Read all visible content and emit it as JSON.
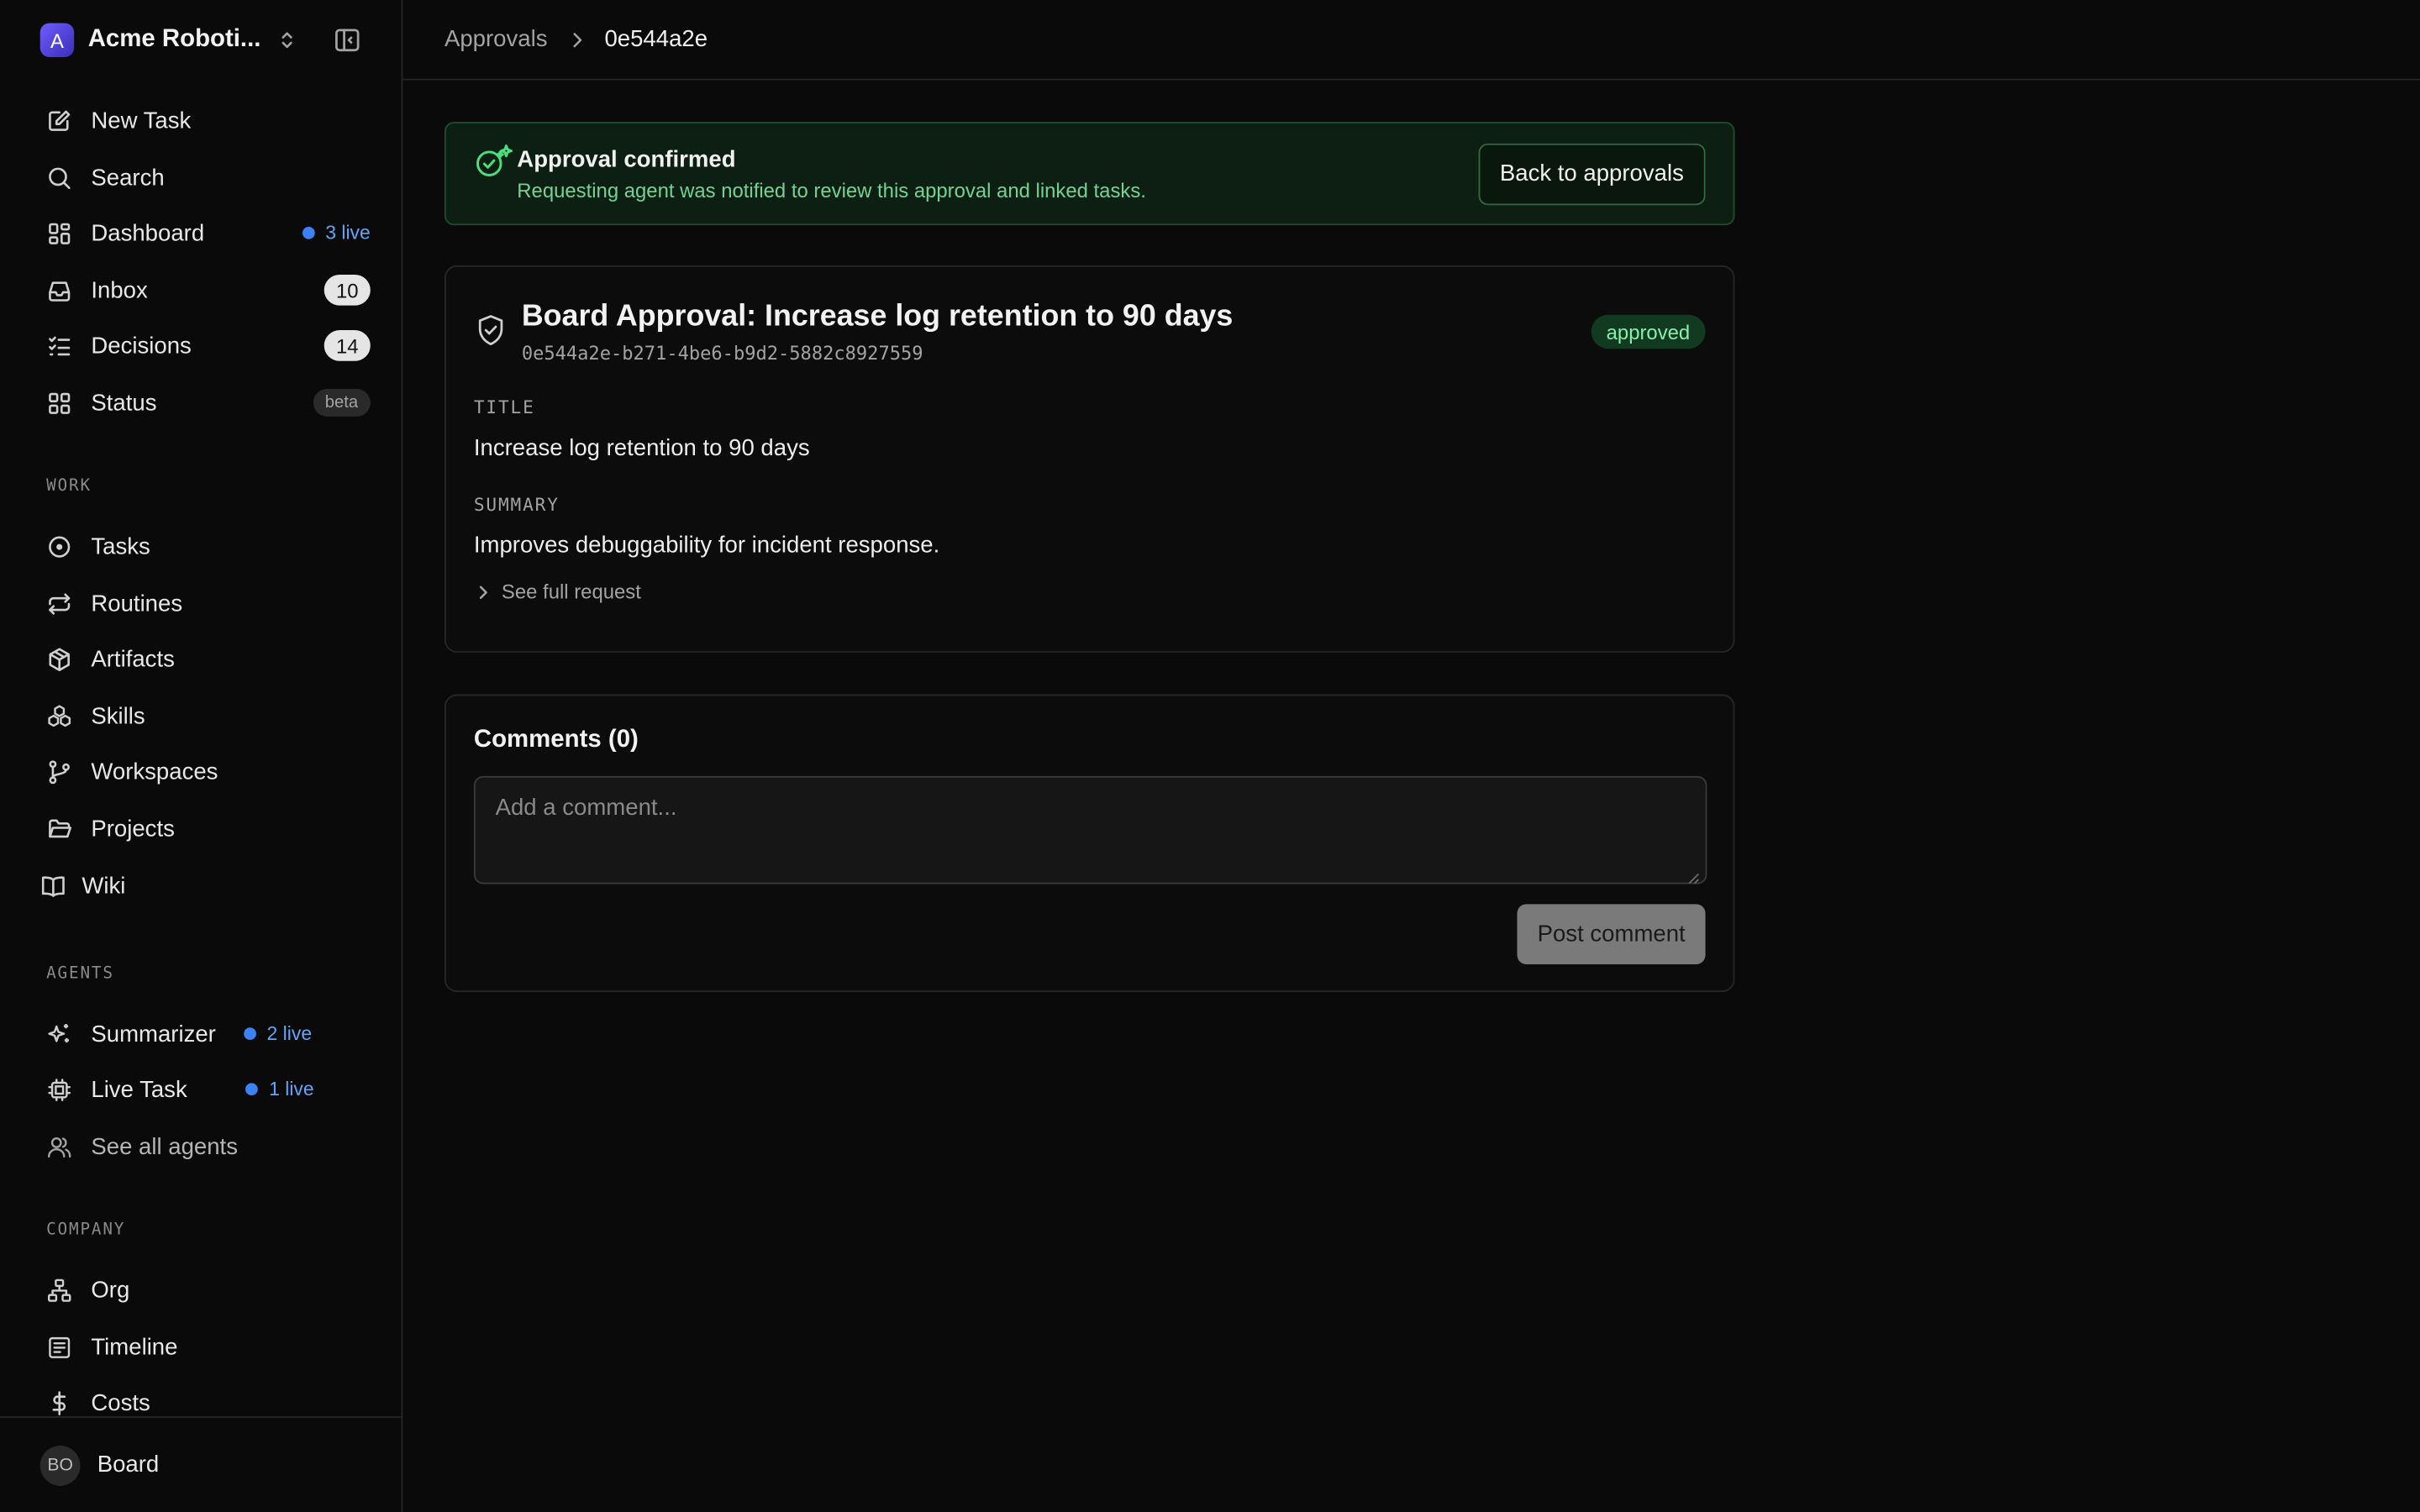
{
  "workspace": {
    "initial": "A",
    "name": "Acme Roboti..."
  },
  "nav_primary": [
    {
      "label": "New Task",
      "icon": "edit-icon"
    },
    {
      "label": "Search",
      "icon": "search-icon"
    },
    {
      "label": "Dashboard",
      "icon": "dashboard-icon",
      "live": "3 live"
    },
    {
      "label": "Inbox",
      "icon": "inbox-icon",
      "count": "10"
    },
    {
      "label": "Decisions",
      "icon": "checklist-icon",
      "count": "14"
    },
    {
      "label": "Status",
      "icon": "grid-icon",
      "badge": "beta"
    }
  ],
  "sections": {
    "work": "WORK",
    "agents": "AGENTS",
    "company": "COMPANY"
  },
  "nav_work": [
    {
      "label": "Tasks"
    },
    {
      "label": "Routines"
    },
    {
      "label": "Artifacts"
    },
    {
      "label": "Skills"
    },
    {
      "label": "Workspaces"
    },
    {
      "label": "Projects"
    },
    {
      "label": "Wiki"
    }
  ],
  "nav_agents": [
    {
      "label": "Summarizer",
      "live": "2 live"
    },
    {
      "label": "Live Task",
      "live": "1 live"
    },
    {
      "label": "See all agents"
    }
  ],
  "nav_company": [
    {
      "label": "Org"
    },
    {
      "label": "Timeline"
    },
    {
      "label": "Costs"
    }
  ],
  "user": {
    "initials": "BO",
    "name": "Board"
  },
  "breadcrumb": {
    "parent": "Approvals",
    "current": "0e544a2e"
  },
  "banner": {
    "title": "Approval confirmed",
    "subtitle": "Requesting agent was notified to review this approval and linked tasks.",
    "button": "Back to approvals"
  },
  "approval": {
    "title": "Board Approval: Increase log retention to 90 days",
    "id": "0e544a2e-b271-4be6-b9d2-5882c8927559",
    "status": "approved",
    "title_label": "TITLE",
    "title_value": "Increase log retention to 90 days",
    "summary_label": "SUMMARY",
    "summary_value": "Improves debuggability for incident response.",
    "see_full": "See full request"
  },
  "comments": {
    "title": "Comments (0)",
    "placeholder": "Add a comment...",
    "post_label": "Post comment"
  },
  "colors": {
    "accent_green": "#4ade80",
    "live_blue": "#3b82f6",
    "background": "#0a0a0a"
  }
}
